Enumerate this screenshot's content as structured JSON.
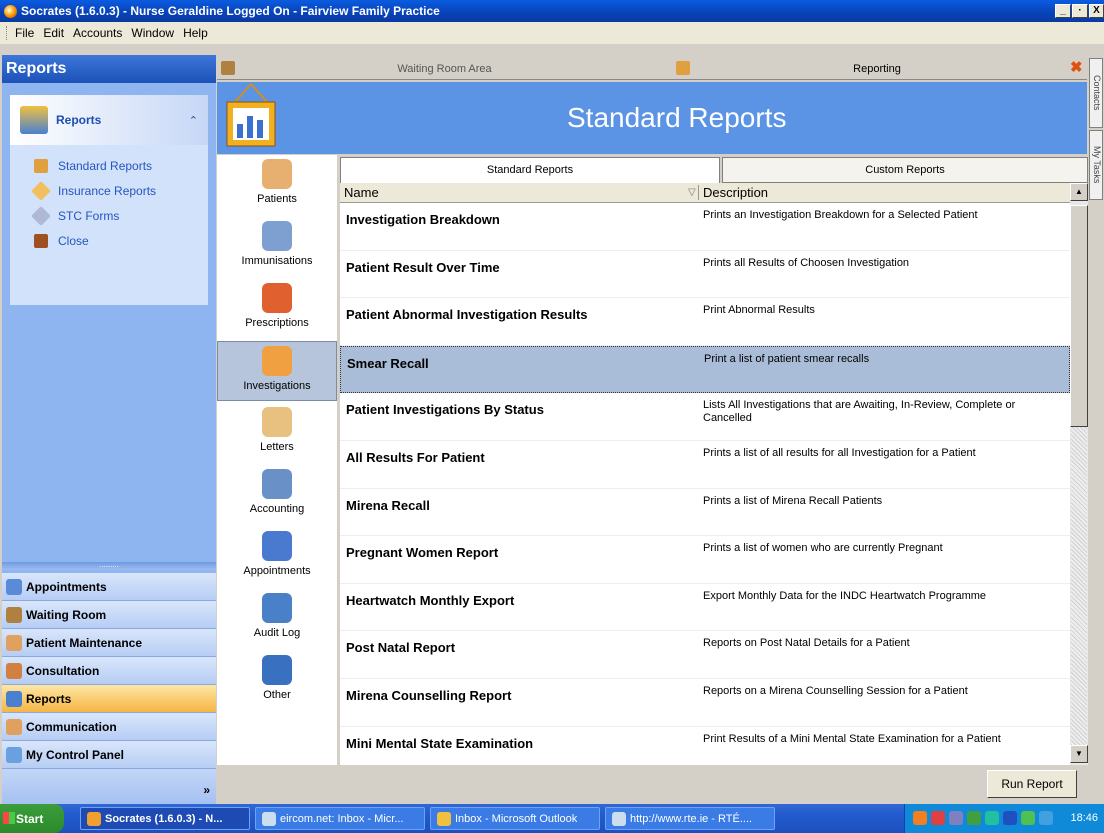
{
  "window": {
    "title": "Socrates (1.6.0.3) - Nurse Geraldine Logged On - Fairview Family Practice",
    "controls": [
      "_",
      "·",
      "X"
    ]
  },
  "menu": [
    "File",
    "Edit",
    "Accounts",
    "Window",
    "Help"
  ],
  "left_pane": {
    "header": "Reports",
    "group_title": "Reports",
    "group_items": [
      {
        "label": "Standard Reports",
        "icon": "reports-icon"
      },
      {
        "label": "Insurance Reports",
        "icon": "insurance-icon"
      },
      {
        "label": "STC Forms",
        "icon": "forms-icon"
      },
      {
        "label": "Close",
        "icon": "close-icon"
      }
    ],
    "nav_buttons": [
      {
        "label": "Appointments",
        "active": false
      },
      {
        "label": "Waiting Room",
        "active": false
      },
      {
        "label": "Patient Maintenance",
        "active": false
      },
      {
        "label": "Consultation",
        "active": false
      },
      {
        "label": "Reports",
        "active": true
      },
      {
        "label": "Communication",
        "active": false
      },
      {
        "label": "My Control Panel",
        "active": false
      }
    ],
    "footer_chevron": "»"
  },
  "doc_tabs": [
    {
      "label": "Waiting Room Area",
      "icon": "waiting-room-icon"
    },
    {
      "label": "Reporting",
      "icon": "reporting-icon"
    }
  ],
  "header": {
    "title": "Standard Reports"
  },
  "side_items": [
    {
      "label": "Patients",
      "active": false,
      "color": "#e8b070"
    },
    {
      "label": "Immunisations",
      "active": false,
      "color": "#7da0d0"
    },
    {
      "label": "Prescriptions",
      "active": false,
      "color": "#e06030"
    },
    {
      "label": "Investigations",
      "active": true,
      "color": "#f0a040"
    },
    {
      "label": "Letters",
      "active": false,
      "color": "#e8c080"
    },
    {
      "label": "Accounting",
      "active": false,
      "color": "#6a90c8"
    },
    {
      "label": "Appointments",
      "active": false,
      "color": "#4a7ad0"
    },
    {
      "label": "Audit Log",
      "active": false,
      "color": "#4a80c8"
    },
    {
      "label": "Other",
      "active": false,
      "color": "#3a70c0"
    }
  ],
  "sub_tabs": [
    "Standard Reports",
    "Custom Reports"
  ],
  "columns": {
    "name": "Name",
    "description": "Description"
  },
  "reports": [
    {
      "name": "Investigation Breakdown",
      "description": "Prints an Investigation Breakdown for a Selected Patient",
      "selected": false
    },
    {
      "name": "Patient Result Over Time",
      "description": "Prints all Results of Choosen Investigation",
      "selected": false
    },
    {
      "name": "Patient Abnormal Investigation Results",
      "description": "Print Abnormal Results",
      "selected": false
    },
    {
      "name": "Smear Recall",
      "description": "Print a list of patient smear recalls",
      "selected": true
    },
    {
      "name": "Patient Investigations By Status",
      "description": "Lists All Investigations that are Awaiting, In-Review, Complete or Cancelled",
      "selected": false
    },
    {
      "name": "All Results For Patient",
      "description": "Prints a list of all results for all Investigation for a Patient",
      "selected": false
    },
    {
      "name": "Mirena Recall",
      "description": "Prints a list of Mirena Recall Patients",
      "selected": false
    },
    {
      "name": "Pregnant Women Report",
      "description": "Prints a list of women who are currently Pregnant",
      "selected": false
    },
    {
      "name": "Heartwatch Monthly Export",
      "description": "Export Monthly Data for the INDC Heartwatch Programme",
      "selected": false
    },
    {
      "name": "Post Natal Report",
      "description": "Reports on Post Natal Details for a Patient",
      "selected": false
    },
    {
      "name": "Mirena Counselling Report",
      "description": "Reports on a Mirena Counselling Session for a Patient",
      "selected": false
    },
    {
      "name": "Mini Mental State Examination",
      "description": "Print Results of a Mini Mental State Examination for a Patient",
      "selected": false
    }
  ],
  "run_button": "Run Report",
  "right_tabs": [
    "Contacts",
    "My Tasks"
  ],
  "taskbar": {
    "start": "Start",
    "tasks": [
      {
        "label": "Socrates (1.6.0.3) - N...",
        "active": true
      },
      {
        "label": "eircom.net: Inbox - Micr...",
        "active": false
      },
      {
        "label": "Inbox - Microsoft Outlook",
        "active": false
      },
      {
        "label": "http://www.rte.ie - RTÉ....",
        "active": false
      }
    ],
    "clock": "18:46"
  }
}
